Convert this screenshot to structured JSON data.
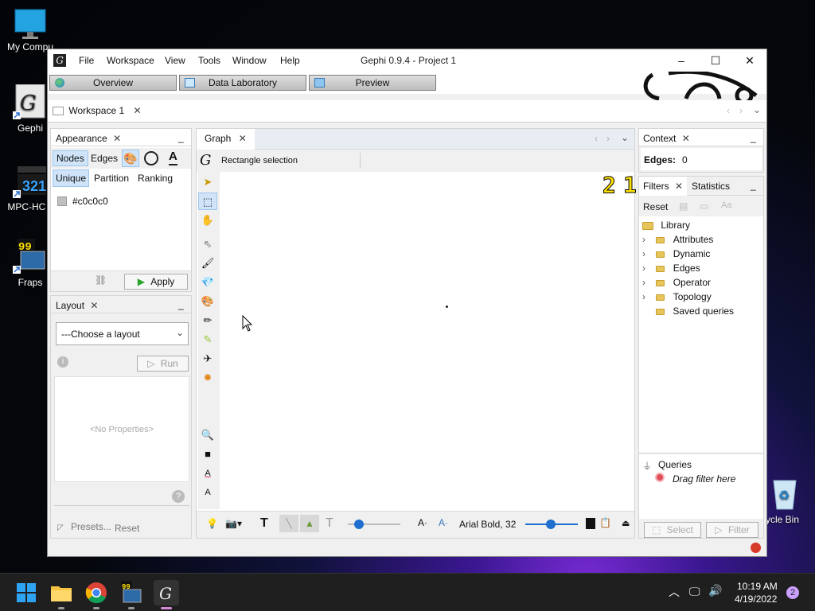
{
  "desktop": {
    "icons": [
      {
        "label": "My Compu",
        "icon": "computer-icon"
      },
      {
        "label": "Gephi",
        "icon": "gephi-icon"
      },
      {
        "label": "MPC-HC x",
        "icon": "mpc-hc-icon"
      },
      {
        "label": "Fraps",
        "icon": "fraps-icon"
      },
      {
        "label": "ycle Bin",
        "icon": "recycle-bin-icon"
      }
    ]
  },
  "window": {
    "title": "Gephi 0.9.4 - Project 1",
    "menu": [
      "File",
      "Workspace",
      "View",
      "Tools",
      "Window",
      "Help"
    ],
    "modes": [
      "Overview",
      "Data Laboratory",
      "Preview"
    ],
    "workspace_tab": "Workspace 1"
  },
  "appearance": {
    "title": "Appearance",
    "element_tabs": [
      "Nodes",
      "Edges"
    ],
    "mode_tabs": [
      "Unique",
      "Partition",
      "Ranking"
    ],
    "color_value": "#c0c0c0",
    "apply_label": "Apply"
  },
  "layout": {
    "title": "Layout",
    "select_value": "---Choose a layout",
    "run_label": "Run",
    "no_properties": "<No Properties>",
    "presets_label": "Presets...",
    "reset_label": "Reset"
  },
  "graph": {
    "title": "Graph",
    "selection_mode": "Rectangle selection",
    "counter_a": "2",
    "counter_b": "1",
    "font_label": "Arial Bold, 32"
  },
  "context": {
    "title": "Context",
    "edges_label": "Edges:",
    "edges_value": "0"
  },
  "filters": {
    "tab_filters": "Filters",
    "tab_statistics": "Statistics",
    "reset_label": "Reset",
    "library_label": "Library",
    "library_items": [
      "Attributes",
      "Dynamic",
      "Edges",
      "Operator",
      "Topology",
      "Saved queries"
    ],
    "queries_label": "Queries",
    "drag_hint": "Drag filter here",
    "select_label": "Select",
    "filter_label": "Filter"
  },
  "taskbar": {
    "time": "10:19 AM",
    "date": "4/19/2022",
    "notifications": "2"
  },
  "colors": {
    "accent": "#1e6fd0",
    "selected_tab": "#cfe4f8",
    "counter": "#ffe200"
  }
}
